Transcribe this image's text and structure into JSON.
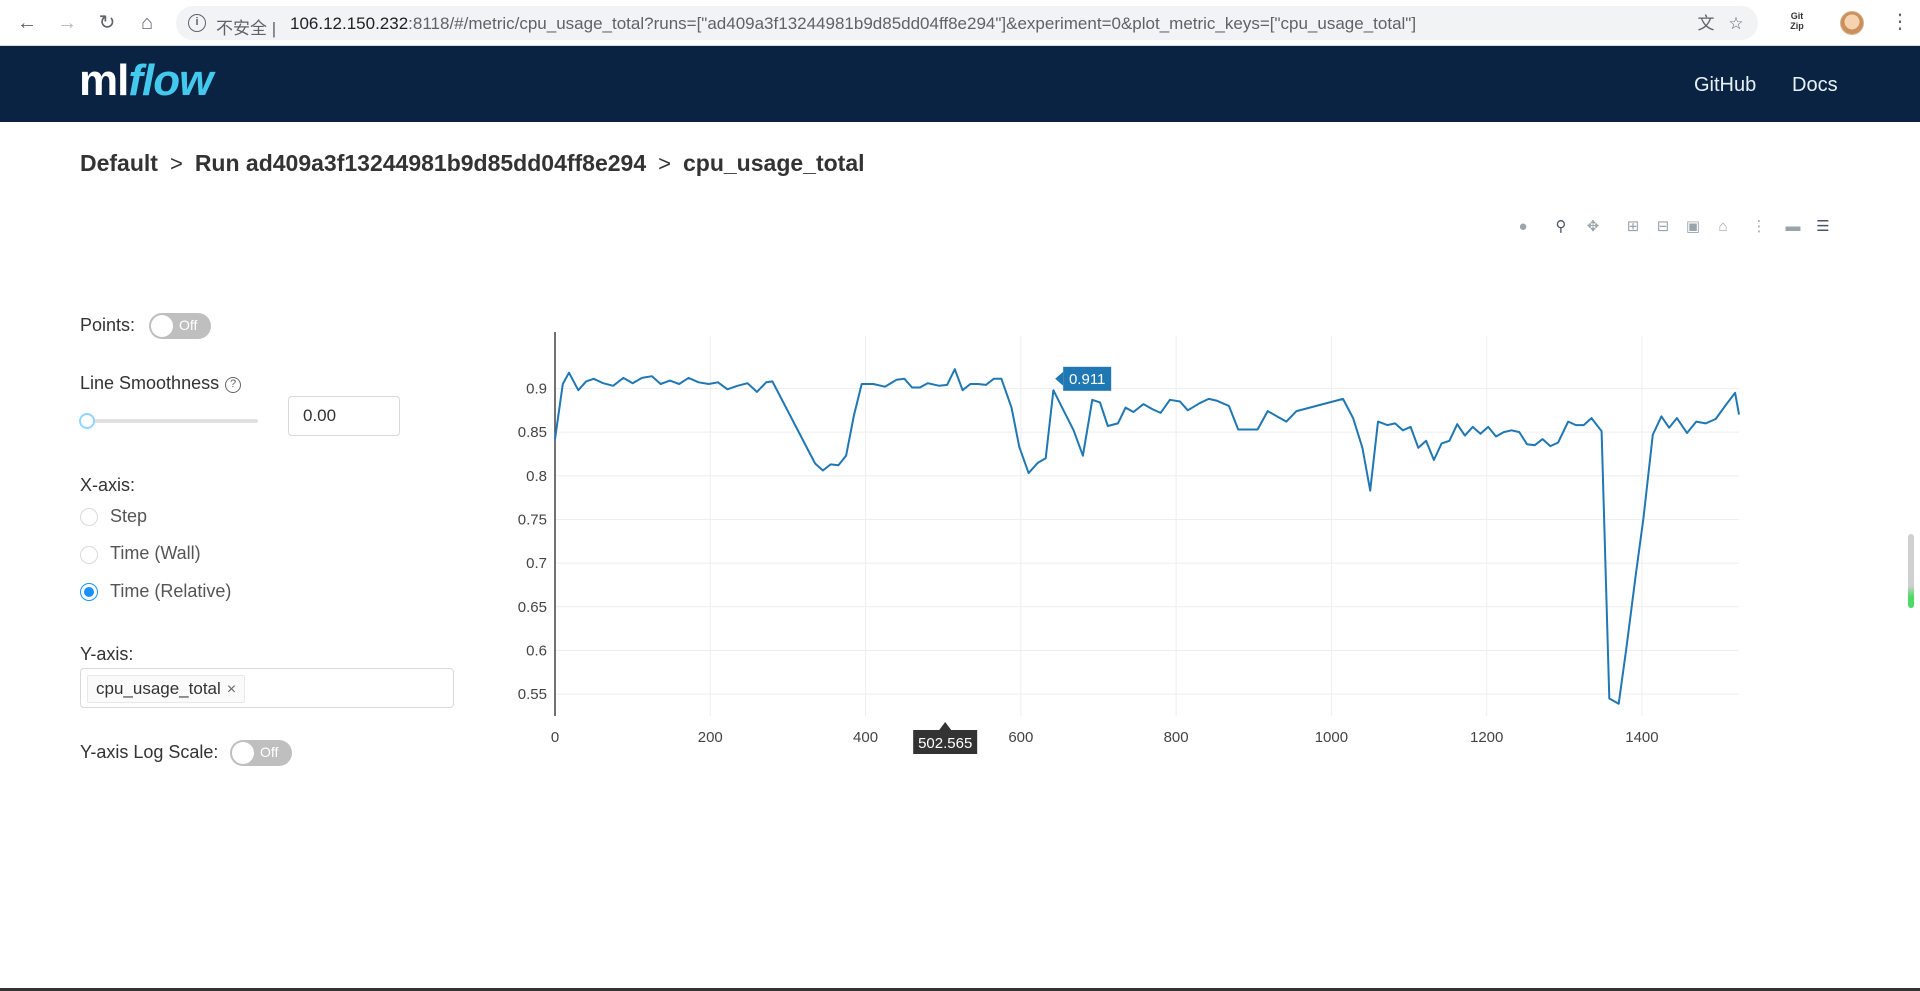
{
  "browser": {
    "back_icon": "arrow-left-icon",
    "forward_icon": "arrow-right-icon",
    "reload_icon": "reload-icon",
    "home_icon": "home-icon",
    "insecure_label": "不安全",
    "url_host": "106.12.150.232",
    "url_rest": ":8118/#/metric/cpu_usage_total?runs=[\"ad409a3f13244981b9d85dd04ff8e294\"]&experiment=0&plot_metric_keys=[\"cpu_usage_total\"]",
    "extension_label": "Git Zip"
  },
  "header": {
    "logo_ml": "ml",
    "logo_flow": "flow",
    "links": [
      "GitHub",
      "Docs"
    ],
    "background": "#0b2343",
    "accent": "#43c9ed"
  },
  "breadcrumb": {
    "items": [
      "Default",
      "Run ad409a3f13244981b9d85dd04ff8e294",
      "cpu_usage_total"
    ],
    "separator": ">"
  },
  "controls": {
    "points_label": "Points:",
    "points_toggle": "Off",
    "smoothness_label": "Line Smoothness",
    "smoothness_value": "0.00",
    "xaxis_label": "X-axis:",
    "xaxis_options": [
      "Step",
      "Time (Wall)",
      "Time (Relative)"
    ],
    "xaxis_selected": "Time (Relative)",
    "yaxis_label": "Y-axis:",
    "yaxis_tag": "cpu_usage_total",
    "log_scale_label": "Y-axis Log Scale:",
    "log_scale_toggle": "Off"
  },
  "chart_data": {
    "type": "line",
    "title": "",
    "xlabel": "",
    "ylabel": "",
    "xlim": [
      0,
      1525
    ],
    "ylim": [
      0.525,
      0.96
    ],
    "xticks": [
      0,
      200,
      400,
      600,
      800,
      1000,
      1200,
      1400
    ],
    "yticks": [
      0.55,
      0.6,
      0.65,
      0.7,
      0.75,
      0.8,
      0.85,
      0.9
    ],
    "grid": true,
    "line_color": "#1f77b4",
    "series": [
      {
        "x": [
          0,
          10,
          18,
          30,
          40,
          50,
          62,
          75,
          88,
          100,
          112,
          125,
          136,
          148,
          160,
          172,
          185,
          198,
          210,
          222,
          235,
          248,
          260,
          272,
          280,
          335,
          345,
          355,
          365,
          375,
          385,
          395,
          410,
          425,
          440,
          450,
          460,
          470,
          480,
          495,
          505,
          515,
          525,
          535,
          545,
          555,
          565,
          575,
          588,
          598,
          610,
          622,
          632,
          642,
          655,
          668,
          680,
          692,
          702,
          712,
          725,
          735,
          745,
          758,
          770,
          780,
          792,
          805,
          815,
          830,
          842,
          852,
          868,
          880,
          892,
          905,
          918,
          930,
          942,
          955,
          1015,
          1028,
          1040,
          1050,
          1060,
          1072,
          1082,
          1092,
          1102,
          1112,
          1122,
          1132,
          1142,
          1152,
          1162,
          1172,
          1182,
          1192,
          1202,
          1212,
          1222,
          1232,
          1242,
          1252,
          1262,
          1272,
          1282,
          1292,
          1305,
          1315,
          1325,
          1335,
          1348,
          1358,
          1370,
          1380,
          1392,
          1402,
          1414,
          1425,
          1435,
          1445,
          1458,
          1470,
          1482,
          1495,
          1508,
          1520,
          1525
        ],
        "y": [
          0.842,
          0.905,
          0.918,
          0.898,
          0.908,
          0.911,
          0.906,
          0.903,
          0.912,
          0.906,
          0.912,
          0.914,
          0.905,
          0.909,
          0.905,
          0.912,
          0.907,
          0.905,
          0.907,
          0.899,
          0.903,
          0.906,
          0.896,
          0.907,
          0.908,
          0.814,
          0.806,
          0.813,
          0.812,
          0.823,
          0.869,
          0.905,
          0.905,
          0.902,
          0.91,
          0.911,
          0.901,
          0.901,
          0.906,
          0.903,
          0.904,
          0.922,
          0.898,
          0.905,
          0.905,
          0.904,
          0.911,
          0.911,
          0.878,
          0.833,
          0.803,
          0.815,
          0.82,
          0.898,
          0.875,
          0.852,
          0.823,
          0.887,
          0.884,
          0.857,
          0.86,
          0.878,
          0.873,
          0.882,
          0.876,
          0.872,
          0.887,
          0.885,
          0.875,
          0.883,
          0.888,
          0.886,
          0.88,
          0.853,
          0.853,
          0.853,
          0.874,
          0.868,
          0.862,
          0.874,
          0.888,
          0.866,
          0.832,
          0.783,
          0.862,
          0.858,
          0.86,
          0.852,
          0.856,
          0.832,
          0.84,
          0.818,
          0.837,
          0.84,
          0.859,
          0.846,
          0.856,
          0.848,
          0.856,
          0.845,
          0.85,
          0.852,
          0.85,
          0.836,
          0.835,
          0.842,
          0.834,
          0.838,
          0.862,
          0.858,
          0.858,
          0.866,
          0.851,
          0.545,
          0.539,
          0.603,
          0.686,
          0.752,
          0.847,
          0.868,
          0.855,
          0.866,
          0.849,
          0.862,
          0.86,
          0.865,
          0.881,
          0.895,
          0.87
        ]
      }
    ],
    "hover": {
      "x_label": "502.565",
      "y_label": "0.911"
    }
  }
}
